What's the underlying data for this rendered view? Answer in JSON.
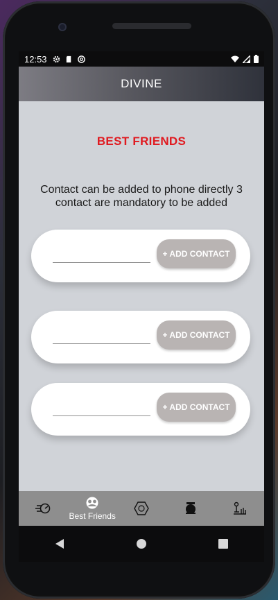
{
  "status_bar": {
    "time": "12:53",
    "icons": [
      "gear-icon",
      "sd-card-icon",
      "at-sign-icon"
    ],
    "right_icons": [
      "wifi-icon",
      "signal-icon",
      "battery-icon"
    ]
  },
  "app_bar": {
    "title": "DIVINE"
  },
  "section_title": "BEST FRIENDS",
  "description": "Contact can be added to phone directly 3 contact are mandatory to be added",
  "contacts": [
    {
      "value": "",
      "button_label": "+ ADD CONTACT"
    },
    {
      "value": "",
      "button_label": "+ ADD CONTACT"
    },
    {
      "value": "",
      "button_label": "+ ADD CONTACT"
    }
  ],
  "bottom_nav": {
    "items": [
      {
        "icon": "speed-icon",
        "label": ""
      },
      {
        "icon": "friends-icon",
        "label": "Best Friends"
      },
      {
        "icon": "hexagon-icon",
        "label": ""
      },
      {
        "icon": "stay-safe-icon",
        "label": ""
      },
      {
        "icon": "chess-icon",
        "label": ""
      }
    ]
  },
  "colors": {
    "accent_red": "#e0191f",
    "button_bg": "#b9b4b3",
    "screen_bg": "#d0d3d8",
    "bottom_nav_bg": "#8e8e8e"
  }
}
